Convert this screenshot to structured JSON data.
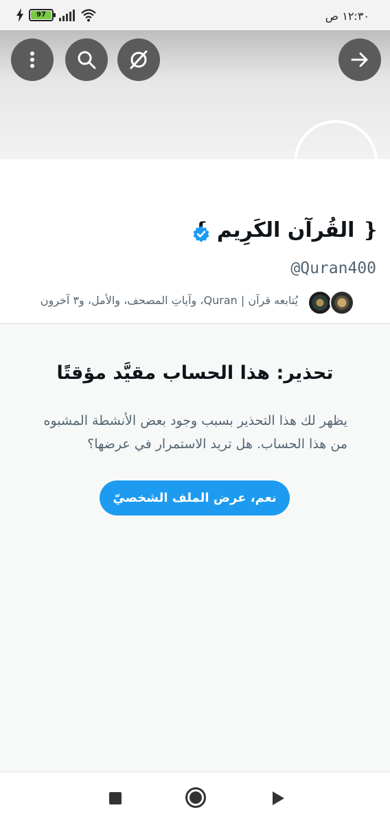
{
  "status": {
    "time": "١٢:٣٠ ص",
    "battery": "97"
  },
  "toolbar": {
    "back_icon": "arrow-right-icon",
    "compass_icon": "compass-icon",
    "search_icon": "search-icon",
    "more_icon": "more-vertical-icon"
  },
  "profile": {
    "display_name": "❴ القُرآن الكَرِيم ❵",
    "handle": "@Quran400",
    "followers_text": "يُتابعه قرآن | Quran، وآياتِ المصحف، والأمل، و٣ آخرون",
    "verified_color": "#1d9bf0"
  },
  "warning": {
    "title": "تحذير: هذا الحساب مقيَّد مؤقتًا",
    "body": "يظهر لك هذا التحذير بسبب وجود بعض الأنشطة المشبوه من هذا الحساب. هل تريد الاستمرار في عرضها؟",
    "button_label": "نعم، عرض الملف الشخصيّ",
    "accent": "#1d9bf0"
  },
  "navigation": {
    "recent_icon": "square-icon",
    "home_icon": "home-circle-icon",
    "back_icon": "triangle-back-icon"
  }
}
